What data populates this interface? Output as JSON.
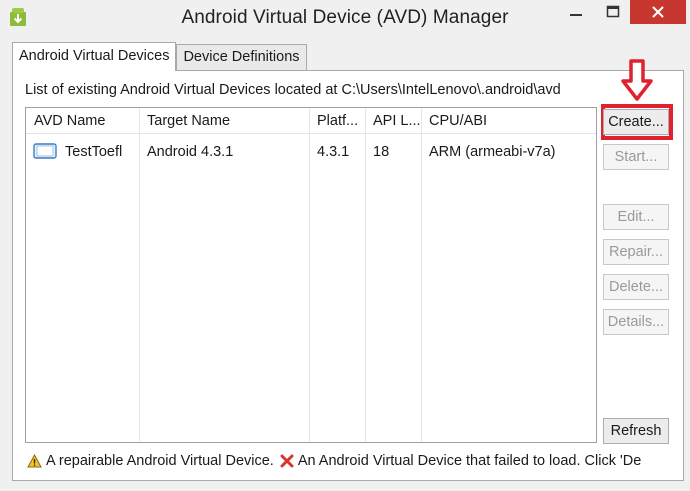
{
  "window": {
    "title": "Android Virtual Device (AVD) Manager",
    "minimize_glyph": "—",
    "maximize_glyph": "□",
    "close_glyph": "✕"
  },
  "tabs": [
    {
      "label": "Android Virtual Devices",
      "active": true
    },
    {
      "label": "Device Definitions",
      "active": false
    }
  ],
  "panel": {
    "caption": "List of existing Android Virtual Devices located at C:\\Users\\IntelLenovo\\.android\\avd"
  },
  "table": {
    "columns": [
      "AVD Name",
      "Target Name",
      "Platf...",
      "API L...",
      "CPU/ABI"
    ],
    "rows": [
      {
        "avd_name": "TestToefl",
        "target_name": "Android 4.3.1",
        "platform": "4.3.1",
        "api_level": "18",
        "cpu_abi": "ARM (armeabi-v7a)",
        "icon": "device-icon"
      }
    ]
  },
  "buttons": {
    "create": "Create...",
    "start": "Start...",
    "edit": "Edit...",
    "repair": "Repair...",
    "delete": "Delete...",
    "details": "Details...",
    "refresh": "Refresh"
  },
  "legend": {
    "repairable": "A repairable Android Virtual Device.",
    "failed": "An Android Virtual Device that failed to load. Click 'De"
  },
  "colors": {
    "highlight": "#e0212e",
    "close_button": "#c7372f",
    "app_icon": "#7cb342"
  }
}
